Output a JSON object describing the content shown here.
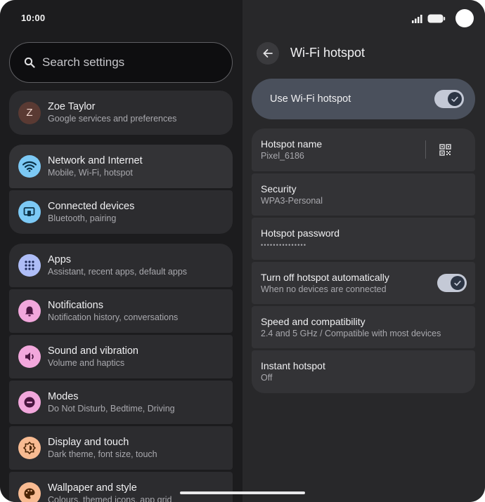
{
  "status": {
    "time": "10:00"
  },
  "search": {
    "placeholder": "Search settings"
  },
  "account": {
    "initial": "Z",
    "name": "Zoe Taylor",
    "subtitle": "Google services and preferences"
  },
  "settings_groups": {
    "network": {
      "title": "Network and Internet",
      "subtitle": "Mobile, Wi-Fi, hotspot",
      "icon": "wifi-icon"
    },
    "connected": {
      "title": "Connected devices",
      "subtitle": "Bluetooth, pairing",
      "icon": "devices-icon"
    },
    "apps": {
      "title": "Apps",
      "subtitle": "Assistant, recent apps, default apps",
      "icon": "apps-grid-icon"
    },
    "notifications": {
      "title": "Notifications",
      "subtitle": "Notification history, conversations",
      "icon": "bell-icon"
    },
    "sound": {
      "title": "Sound and vibration",
      "subtitle": "Volume and haptics",
      "icon": "speaker-icon"
    },
    "modes": {
      "title": "Modes",
      "subtitle": "Do Not Disturb, Bedtime, Driving",
      "icon": "minus-circle-icon"
    },
    "display": {
      "title": "Display and touch",
      "subtitle": "Dark theme, font size, touch",
      "icon": "brightness-icon"
    },
    "wallpaper": {
      "title": "Wallpaper and style",
      "subtitle": "Colours, themed icons, app grid",
      "icon": "palette-icon"
    }
  },
  "hotspot": {
    "title": "Wi-Fi hotspot",
    "master_label": "Use Wi-Fi hotspot",
    "master_on": true,
    "name_label": "Hotspot name",
    "name_value": "Pixel_6186",
    "security_label": "Security",
    "security_value": "WPA3-Personal",
    "password_label": "Hotspot password",
    "password_mask": "•••••••••••••••",
    "auto_off_label": "Turn off hotspot automatically",
    "auto_off_sub": "When no devices are connected",
    "auto_off_on": true,
    "speed_label": "Speed and compatibility",
    "speed_value": "2.4 and 5 GHz / Compatible with most devices",
    "instant_label": "Instant hotspot",
    "instant_value": "Off"
  },
  "colors": {
    "network_icon": "#7cc9f5",
    "connected_icon": "#7cc9f5",
    "apps_icon": "#aebdf7",
    "notifications_icon": "#f2a7dc",
    "sound_icon": "#f2a7dc",
    "modes_icon": "#f2a7dc",
    "display_icon": "#f8bb92",
    "wallpaper_icon": "#f8bb92",
    "avatar": "#5a3a33"
  }
}
